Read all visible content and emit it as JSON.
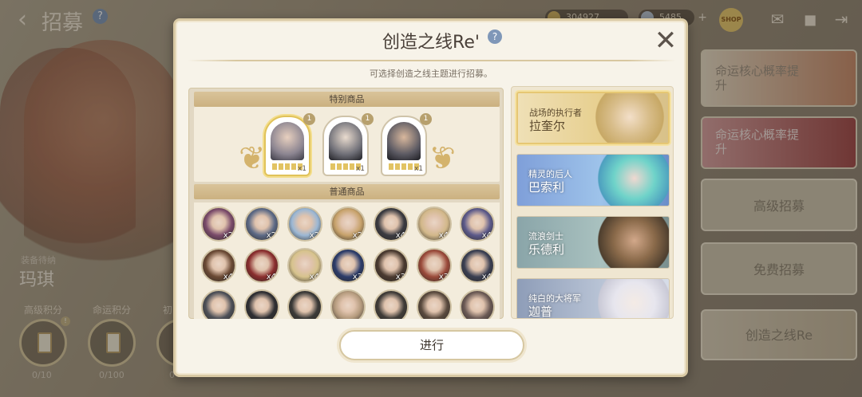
{
  "topbar": {
    "back_icon": "back-arrow-icon",
    "title": "招募",
    "help": "?",
    "resources": [
      {
        "icon": "gold-coin-icon",
        "value": "304927"
      },
      {
        "icon": "gem-icon",
        "value": "5485"
      }
    ],
    "shop_badge": "SHOP",
    "icons": [
      "mail-icon",
      "chat-icon",
      "exit-icon"
    ]
  },
  "background_panel": {
    "hero_tag": "装备待纳",
    "hero_name": "玛琪",
    "points": [
      {
        "label": "高级积分",
        "value": "0/10",
        "badge": "!"
      },
      {
        "label": "命运积分",
        "value": "0/100"
      },
      {
        "label": "初",
        "value": "0"
      }
    ]
  },
  "side_menu": {
    "items": [
      {
        "label": "命运核心概率提升"
      },
      {
        "label": "命运核心概率提升"
      },
      {
        "label": "高级招募"
      },
      {
        "label": "免费招募"
      },
      {
        "label": "创造之线Re"
      }
    ]
  },
  "modal": {
    "title": "创造之线Re'",
    "help": "?",
    "close": "✕",
    "subtitle": "可选择创造之线主题进行招募。",
    "special_label": "特别商品",
    "normal_label": "普通商品",
    "special_items": [
      {
        "count": "x1",
        "badge": "1",
        "selected": true
      },
      {
        "count": "x1",
        "badge": "1",
        "selected": false
      },
      {
        "count": "x1",
        "badge": "1",
        "selected": false
      }
    ],
    "normal_items": [
      {
        "qty": "x2"
      },
      {
        "qty": "x2"
      },
      {
        "qty": "x2"
      },
      {
        "qty": "x2"
      },
      {
        "qty": "x4"
      },
      {
        "qty": "x4"
      },
      {
        "qty": "x4"
      },
      {
        "qty": "x4"
      },
      {
        "qty": "x4"
      },
      {
        "qty": "x4"
      },
      {
        "qty": "x3"
      },
      {
        "qty": "x3"
      },
      {
        "qty": "x3"
      },
      {
        "qty": "x4"
      },
      {
        "qty": ""
      },
      {
        "qty": ""
      },
      {
        "qty": ""
      },
      {
        "qty": ""
      },
      {
        "qty": ""
      },
      {
        "qty": ""
      },
      {
        "qty": ""
      }
    ],
    "heroes": [
      {
        "subtitle": "战场的执行者",
        "name": "拉奎尔",
        "selected": true
      },
      {
        "subtitle": "精灵的后人",
        "name": "巴索利",
        "selected": false
      },
      {
        "subtitle": "流浪剑士",
        "name": "乐德利",
        "selected": false
      },
      {
        "subtitle": "纯白的大将军",
        "name": "迦普",
        "selected": false
      }
    ],
    "confirm_label": "进行"
  },
  "colors": {
    "modal_bg": "#f7f3e9",
    "gold_accent": "#d4b36c",
    "help_blue": "#7f97b8"
  }
}
